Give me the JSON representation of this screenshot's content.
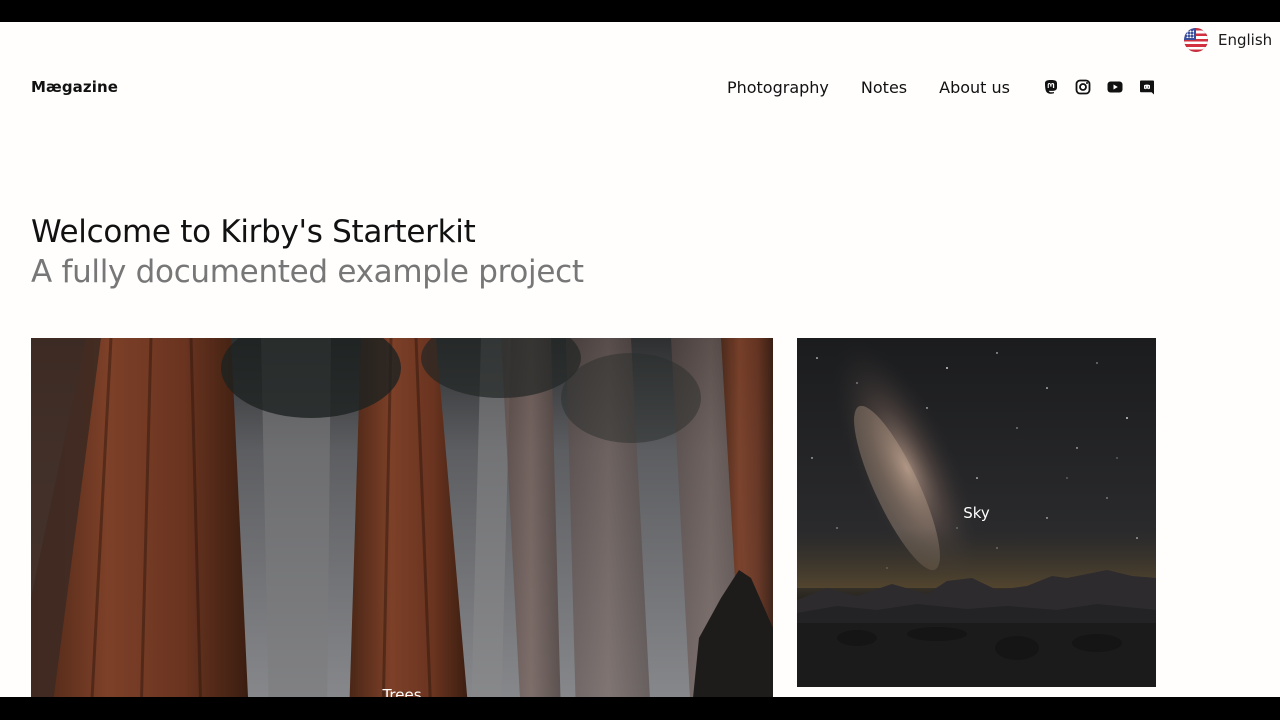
{
  "language": {
    "label": "English",
    "flag_icon": "us-flag-icon"
  },
  "header": {
    "logo": "Mægazine",
    "nav": [
      {
        "label": "Photography"
      },
      {
        "label": "Notes"
      },
      {
        "label": "About us"
      }
    ],
    "social_icons": [
      "mastodon-icon",
      "instagram-icon",
      "youtube-icon",
      "discord-icon"
    ]
  },
  "intro": {
    "title": "Welcome to Kirby's Starterkit",
    "subtitle": "A fully documented example project"
  },
  "gallery": {
    "items": [
      {
        "label": "Trees"
      },
      {
        "label": "Sky"
      }
    ]
  },
  "colors": {
    "background": "#fffefd",
    "text": "#111111",
    "subtitle": "#777777"
  }
}
